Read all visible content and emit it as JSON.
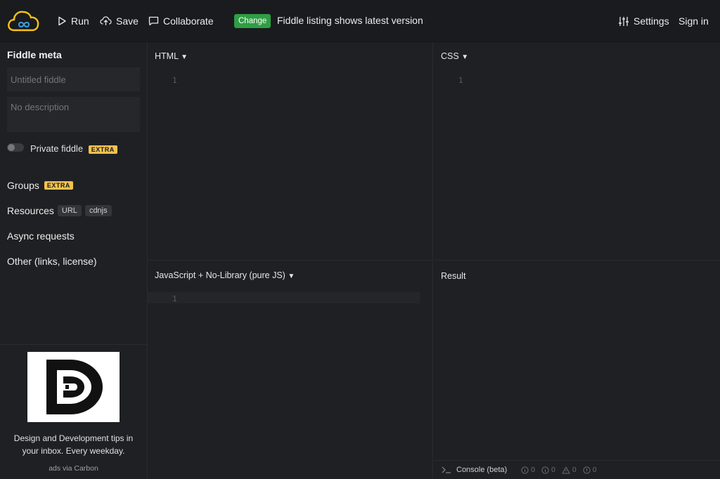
{
  "topbar": {
    "run_label": "Run",
    "save_label": "Save",
    "collaborate_label": "Collaborate",
    "change_badge": "Change",
    "change_text": "Fiddle listing shows latest version",
    "settings_label": "Settings",
    "signin_label": "Sign in"
  },
  "sidebar": {
    "meta_title": "Fiddle meta",
    "title_placeholder": "Untitled fiddle",
    "description_placeholder": "No description",
    "private_label": "Private fiddle",
    "extra_badge": "EXTRA",
    "groups_label": "Groups",
    "resources_label": "Resources",
    "resources_tags": [
      "URL",
      "cdnjs"
    ],
    "async_label": "Async requests",
    "other_label": "Other (links, license)"
  },
  "ad": {
    "text": "Design and Development tips in your inbox. Every weekday.",
    "via": "ads via Carbon"
  },
  "panels": {
    "html_label": "HTML",
    "css_label": "CSS",
    "js_label": "JavaScript + No-Library (pure JS)",
    "result_label": "Result",
    "line_number": "1"
  },
  "console": {
    "label": "Console (beta)",
    "info_count": "0",
    "log_count": "0",
    "warn_count": "0",
    "error_count": "0"
  },
  "colors": {
    "accent_green": "#2f9e44",
    "extra_yellow": "#f2c14e",
    "logo_yellow": "#f5c518"
  }
}
